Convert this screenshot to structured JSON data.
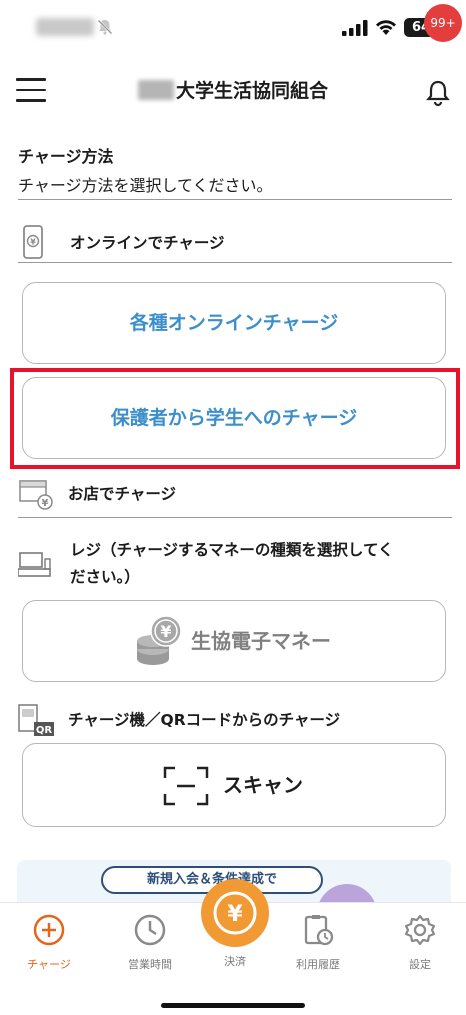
{
  "status_bar": {
    "battery": "64"
  },
  "header": {
    "title": "大学生活協同組合",
    "notification_badge": "99+"
  },
  "charge": {
    "title": "チャージ方法",
    "description": "チャージ方法を選択してください。"
  },
  "online": {
    "label": "オンラインでチャージ",
    "buttons": [
      {
        "label": "各種オンラインチャージ"
      },
      {
        "label": "保護者から学生へのチャージ"
      }
    ]
  },
  "store": {
    "label": "お店でチャージ",
    "register_label_line1": "レジ（チャージするマネーの種類を選択してく",
    "register_label_line2": "ださい。）",
    "coop_money_button": "生協電子マネー",
    "machine_label": "チャージ機／QRコードからのチャージ",
    "scan_button": "スキャン"
  },
  "banner": {
    "pill_text": "新規入会＆条件達成で"
  },
  "tabs": [
    {
      "label": "チャージ",
      "icon": "plus-circle-icon",
      "active": true
    },
    {
      "label": "営業時間",
      "icon": "clock-icon",
      "active": false
    },
    {
      "label": "決済",
      "icon": "yen-icon",
      "active": false
    },
    {
      "label": "利用履歴",
      "icon": "history-icon",
      "active": false
    },
    {
      "label": "設定",
      "icon": "gear-icon",
      "active": false
    }
  ],
  "colors": {
    "accent_blue": "#3d8fcb",
    "accent_orange": "#e6631c",
    "highlight_red": "#e5142c",
    "badge_red": "#e33d3d"
  }
}
